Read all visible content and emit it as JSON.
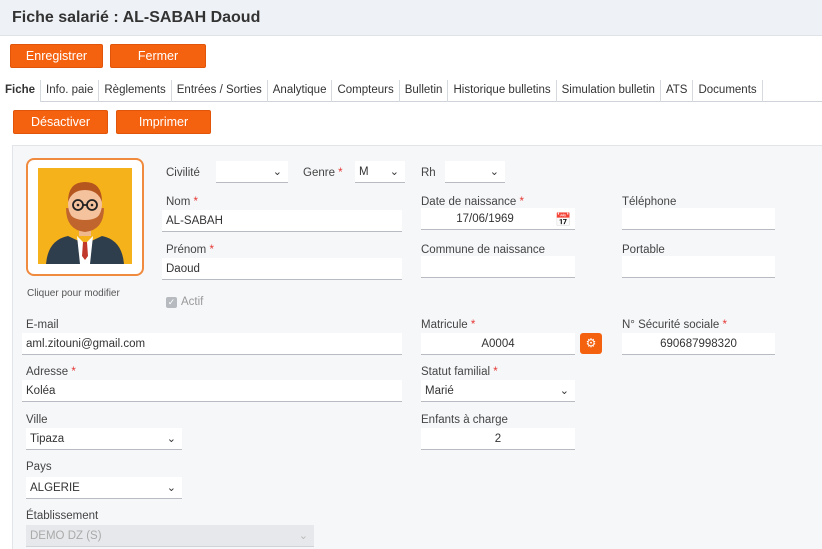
{
  "header": {
    "title": "Fiche salarié : AL-SABAH Daoud"
  },
  "toolbar": {
    "save_label": "Enregistrer",
    "close_label": "Fermer"
  },
  "tabs": [
    "Fiche",
    "Info. paie",
    "Règlements",
    "Entrées / Sorties",
    "Analytique",
    "Compteurs",
    "Bulletin",
    "Historique bulletins",
    "Simulation bulletin",
    "ATS",
    "Documents"
  ],
  "actions": {
    "deactivate_label": "Désactiver",
    "print_label": "Imprimer"
  },
  "photo": {
    "caption": "Cliquer pour modifier"
  },
  "form": {
    "civilite": {
      "label": "Civilité",
      "value": ""
    },
    "genre": {
      "label": "Genre",
      "value": "M"
    },
    "rh": {
      "label": "Rh",
      "value": ""
    },
    "nom": {
      "label": "Nom",
      "value": "AL-SABAH"
    },
    "prenom": {
      "label": "Prénom",
      "value": "Daoud"
    },
    "date_naissance": {
      "label": "Date de naissance",
      "value": "17/06/1969"
    },
    "commune_naissance": {
      "label": "Commune de naissance",
      "value": ""
    },
    "telephone": {
      "label": "Téléphone",
      "value": ""
    },
    "portable": {
      "label": "Portable",
      "value": ""
    },
    "actif": {
      "label": "Actif",
      "checked": true
    },
    "email": {
      "label": "E-mail",
      "value": "aml.zitouni@gmail.com"
    },
    "matricule": {
      "label": "Matricule",
      "value": "A0004"
    },
    "secu": {
      "label": "N° Sécurité sociale",
      "value": "690687998320"
    },
    "adresse": {
      "label": "Adresse",
      "value": "Koléa"
    },
    "statut_familial": {
      "label": "Statut familial",
      "value": "Marié"
    },
    "ville": {
      "label": "Ville",
      "value": "Tipaza"
    },
    "enfants": {
      "label": "Enfants à charge",
      "value": "2"
    },
    "pays": {
      "label": "Pays",
      "value": "ALGERIE"
    },
    "etablissement": {
      "label": "Établissement",
      "value": "DEMO DZ (S)"
    }
  },
  "required_marker": "*",
  "colors": {
    "accent": "#f5620f",
    "photo_border": "#f08a3e",
    "required": "#e53935"
  }
}
